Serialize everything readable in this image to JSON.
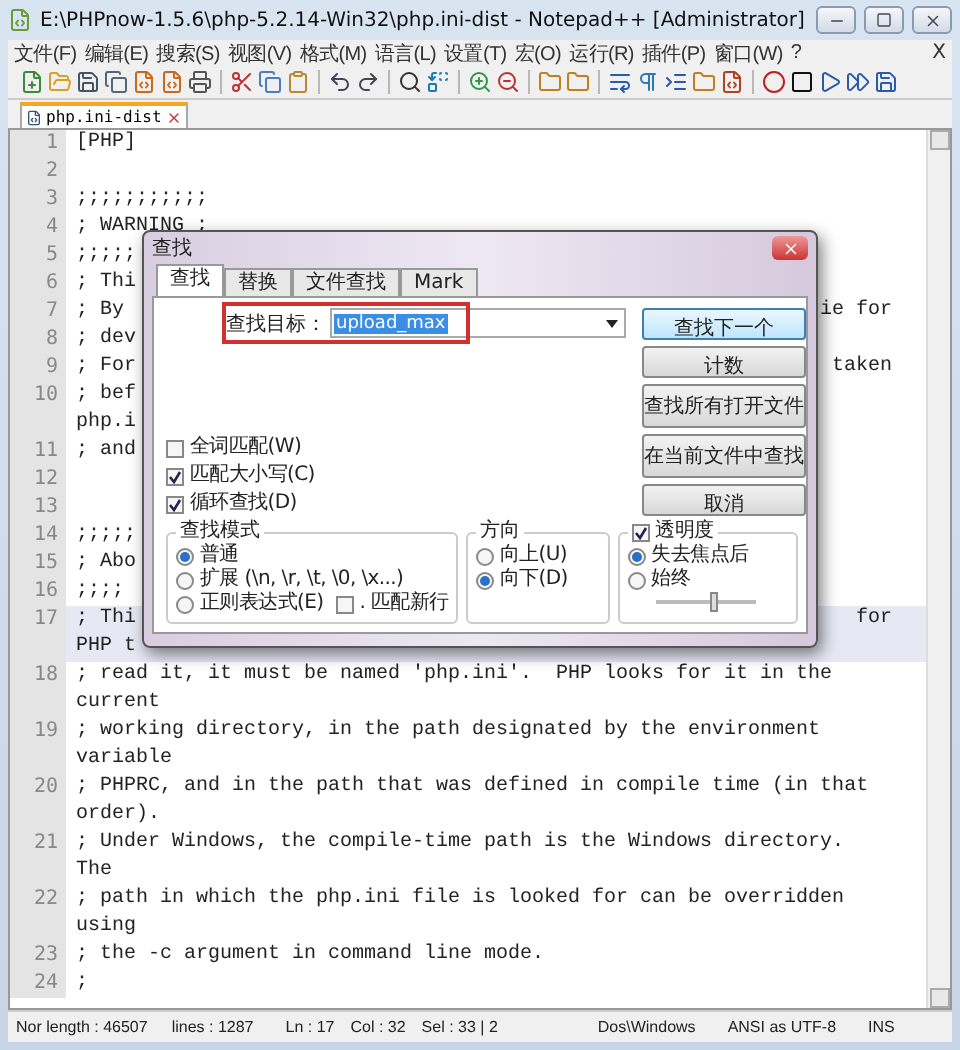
{
  "window": {
    "title": "E:\\PHPnow-1.5.6\\php-5.2.14-Win32\\php.ini-dist - Notepad++ [Administrator]"
  },
  "menu": [
    "文件(F)",
    "编辑(E)",
    "搜索(S)",
    "视图(V)",
    "格式(M)",
    "语言(L)",
    "设置(T)",
    "宏(O)",
    "运行(R)",
    "插件(P)",
    "窗口(W)",
    "?"
  ],
  "menu_close": "X",
  "tabs": [
    {
      "label": "php.ini-dist",
      "selected": true
    }
  ],
  "editor": {
    "lines": [
      {
        "number": "1",
        "text": "[PHP]",
        "selected": false
      },
      {
        "number": "2",
        "selected": false
      },
      {
        "number": "3",
        "text": ";;;;;;;;;;;",
        "selected": false
      },
      {
        "number": "4",
        "text": "; WARNING ;",
        "selected": false
      },
      {
        "number": "5",
        "text": ";;;;;",
        "selected": false
      },
      {
        "number": "6",
        "text": "; Thi",
        "selected": false
      },
      {
        "number": "7",
        "text": "; By",
        "tail": "ie for",
        "selected": false
      },
      {
        "number": "8",
        "text": "; dev",
        "selected": false
      },
      {
        "number": "9",
        "text": "; For",
        "tail": "taken",
        "selected": false
      },
      {
        "number": "10",
        "text": "; bef",
        "wrap": "php.i",
        "selected": false
      },
      {
        "number": "11",
        "text": "; and",
        "selected": false
      },
      {
        "number": "12",
        "selected": false
      },
      {
        "number": "13",
        "selected": false
      },
      {
        "number": "14",
        "text": ";;;;;",
        "selected": false
      },
      {
        "number": "15",
        "text": "; Abo",
        "selected": false
      },
      {
        "number": "16",
        "text": ";;;;",
        "selected": false
      },
      {
        "number": "17",
        "text": "; Thi",
        "tail": "for",
        "wrap": "PHP t",
        "selected": true
      },
      {
        "number": "18",
        "text": "; read it, it must be named 'php.ini'.  PHP looks for it in the",
        "wrap": "current",
        "selected": false
      },
      {
        "number": "19",
        "text": "; working directory, in the path designated by the environment",
        "wrap": "variable",
        "selected": false
      },
      {
        "number": "20",
        "text": "; PHPRC, and in the path that was defined in compile time (in that",
        "wrap": "order).",
        "selected": false
      },
      {
        "number": "21",
        "text": "; Under Windows, the compile-time path is the Windows directory.",
        "wrap": "The",
        "selected": false
      },
      {
        "number": "22",
        "text": "; path in which the php.ini file is looked for can be overridden",
        "wrap": "using",
        "selected": false
      },
      {
        "number": "23",
        "text": "; the -c argument in command line mode.",
        "selected": false
      },
      {
        "number": "24",
        "text": ";",
        "selected": false
      }
    ]
  },
  "dialog": {
    "title": "查找",
    "tabs": [
      {
        "label": "查找",
        "selected": true
      },
      {
        "label": "替换",
        "selected": false
      },
      {
        "label": "文件查找",
        "selected": false
      },
      {
        "label": "Mark",
        "selected": false
      }
    ],
    "find_label": "查找目标：",
    "find_value": "upload_max",
    "buttons": [
      {
        "label": "查找下一个",
        "default": true
      },
      {
        "label": "计数",
        "default": false
      },
      {
        "label": "查找所有打开文件",
        "default": false
      },
      {
        "label": "在当前文件中查找",
        "default": false
      },
      {
        "label": "取消",
        "default": false
      }
    ],
    "options": [
      {
        "label": "全词匹配(W)",
        "checked": false
      },
      {
        "label": "匹配大小写(C)",
        "checked": true
      },
      {
        "label": "循环查找(D)",
        "checked": true
      }
    ],
    "search_mode": {
      "title": "查找模式",
      "options": [
        {
          "label": "普通",
          "selected": true
        },
        {
          "label": "扩展 (\\n, \\r, \\t, \\0, \\x...)",
          "selected": false
        },
        {
          "label": "正则表达式(E)",
          "selected": false
        }
      ],
      "newline": {
        "label": ". 匹配新行",
        "checked": false
      }
    },
    "direction": {
      "title": "方向",
      "options": [
        {
          "label": "向上(U)",
          "selected": false
        },
        {
          "label": "向下(D)",
          "selected": true
        }
      ]
    },
    "transparency": {
      "label": "透明度",
      "checked": true,
      "options": [
        {
          "label": "失去焦点后",
          "selected": true
        },
        {
          "label": "始终",
          "selected": false
        }
      ],
      "level": 0.6
    }
  },
  "status_bar": [
    "Nor length : 46507",
    "lines : 1287",
    "Ln : 17",
    "Col : 32",
    "Sel : 33 | 2",
    "Dos\\Windows",
    "ANSI as UTF-8",
    "INS"
  ]
}
